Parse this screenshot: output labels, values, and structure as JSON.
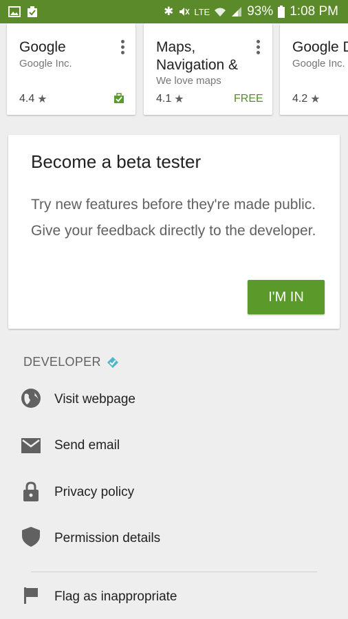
{
  "status_bar": {
    "network_label": "LTE",
    "battery": "93%",
    "time": "1:08 PM",
    "icons": [
      "image-icon",
      "clipboard-icon",
      "bluetooth-icon",
      "mute-icon",
      "wifi-icon",
      "signal-icon",
      "battery-icon"
    ]
  },
  "apps": [
    {
      "title": "Google",
      "developer": "Google Inc.",
      "rating": "4.4",
      "badge": "installed-icon"
    },
    {
      "title": "Maps, Navigation &",
      "developer": "We love maps",
      "rating": "4.1",
      "price": "FREE"
    },
    {
      "title": "Google D",
      "developer": "Google Inc.",
      "rating": "4.2"
    }
  ],
  "beta": {
    "title": "Become a beta tester",
    "body": "Try new features before they're made public. Give your feedback directly to the developer.",
    "button": "I'M IN"
  },
  "developer": {
    "title": "DEVELOPER",
    "items": [
      {
        "label": "Visit webpage",
        "icon": "globe-icon"
      },
      {
        "label": "Send email",
        "icon": "email-icon"
      },
      {
        "label": "Privacy policy",
        "icon": "lock-icon"
      },
      {
        "label": "Permission details",
        "icon": "shield-icon"
      }
    ],
    "flag": {
      "label": "Flag as inappropriate",
      "icon": "flag-icon"
    }
  },
  "colors": {
    "accent": "#5a9a2b",
    "status_bar": "#5a8a2a",
    "verified": "#4fb7c9"
  }
}
